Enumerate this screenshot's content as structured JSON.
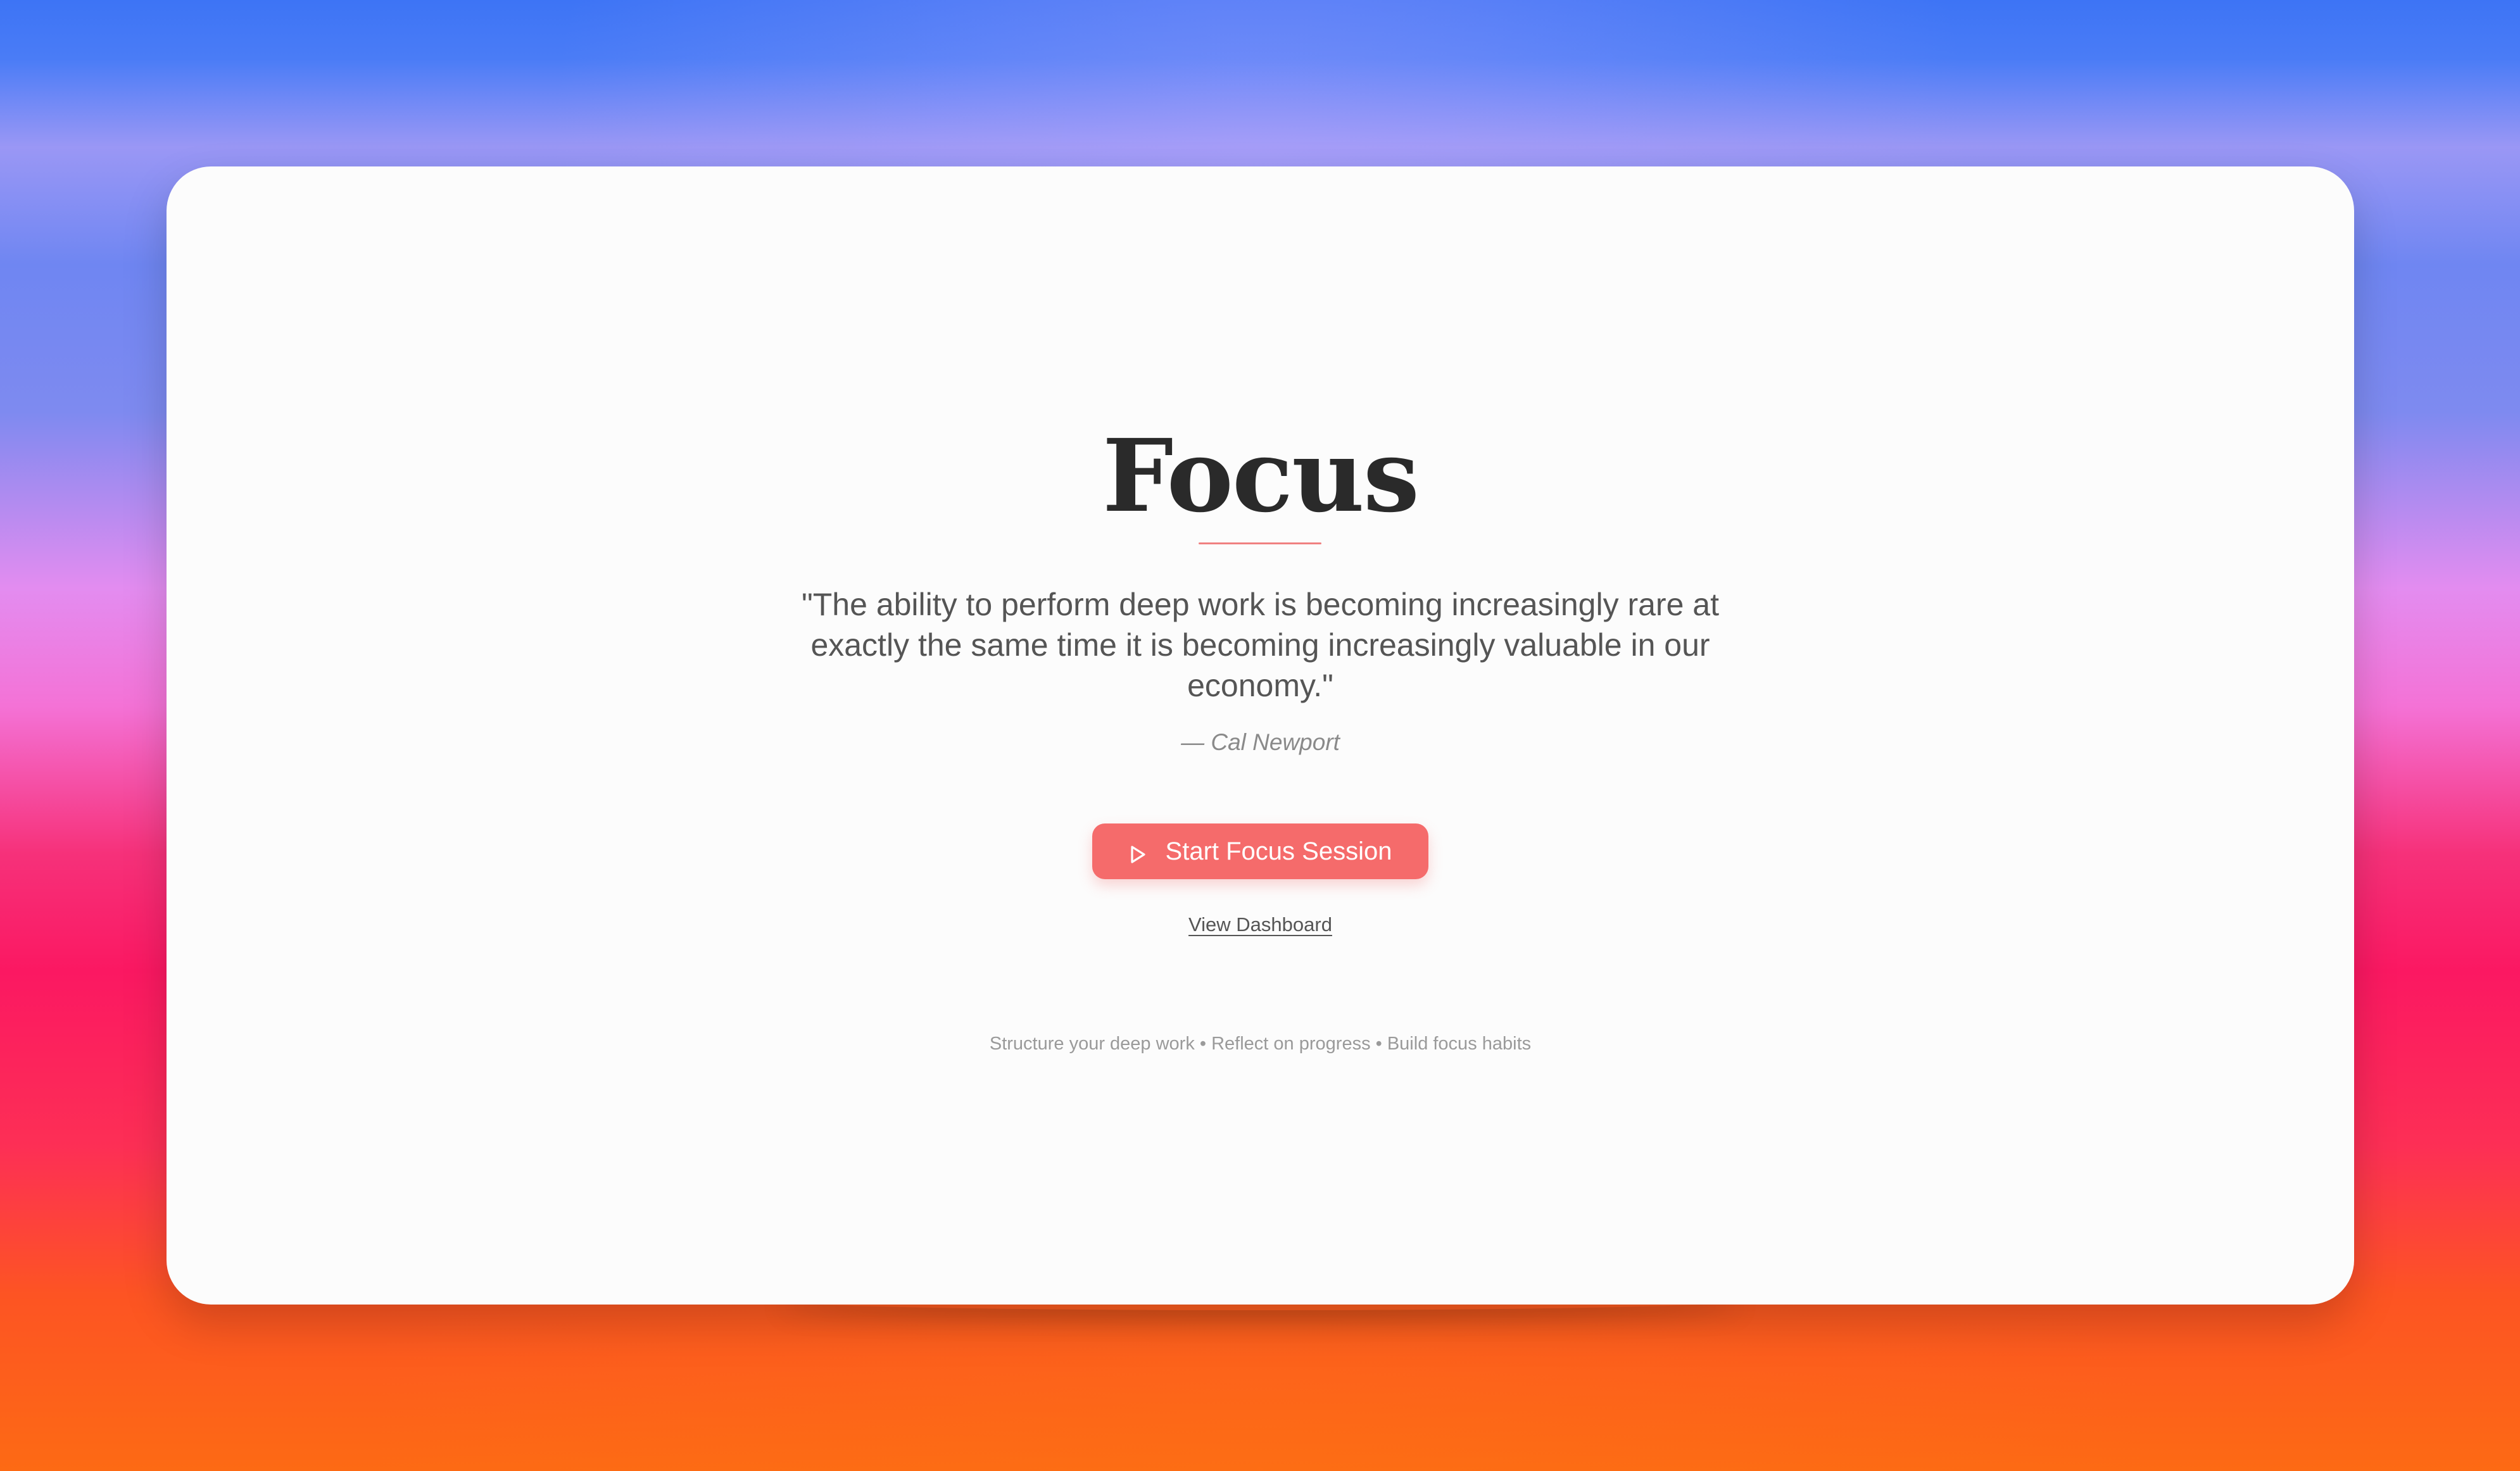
{
  "hero": {
    "title": "Focus",
    "quote": "\"The ability to perform deep work is becoming increasingly rare at exactly the same time it is becoming increasingly valuable in our economy.\"",
    "author": "— Cal Newport"
  },
  "actions": {
    "start_label": "Start Focus Session",
    "start_icon": "play-icon",
    "dashboard_label": "View Dashboard"
  },
  "footer": {
    "tagline": "Structure your deep work • Reflect on progress • Build focus habits"
  },
  "colors": {
    "accent": "#f56b6b",
    "title": "#2a2a2a",
    "card": "#fcfcfc"
  }
}
